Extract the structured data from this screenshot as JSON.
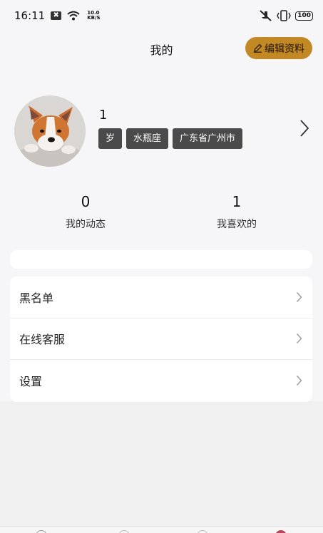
{
  "status_bar": {
    "time": "16:11",
    "net_speed_value": "10.0",
    "net_speed_unit": "KB/S",
    "battery": "100"
  },
  "header": {
    "title": "我的",
    "edit_button_label": "编辑资料"
  },
  "profile": {
    "username": "1",
    "tags": [
      "岁",
      "水瓶座",
      "广东省广州市"
    ]
  },
  "stats": [
    {
      "value": "0",
      "label": "我的动态"
    },
    {
      "value": "1",
      "label": "我喜欢的"
    }
  ],
  "menu": {
    "items": [
      {
        "label": "黑名单"
      },
      {
        "label": "在线客服"
      },
      {
        "label": "设置"
      }
    ]
  },
  "colors": {
    "accent": "#c28823",
    "tag_bg": "#4a4a4a",
    "page_bg": "#f6f6f8"
  }
}
